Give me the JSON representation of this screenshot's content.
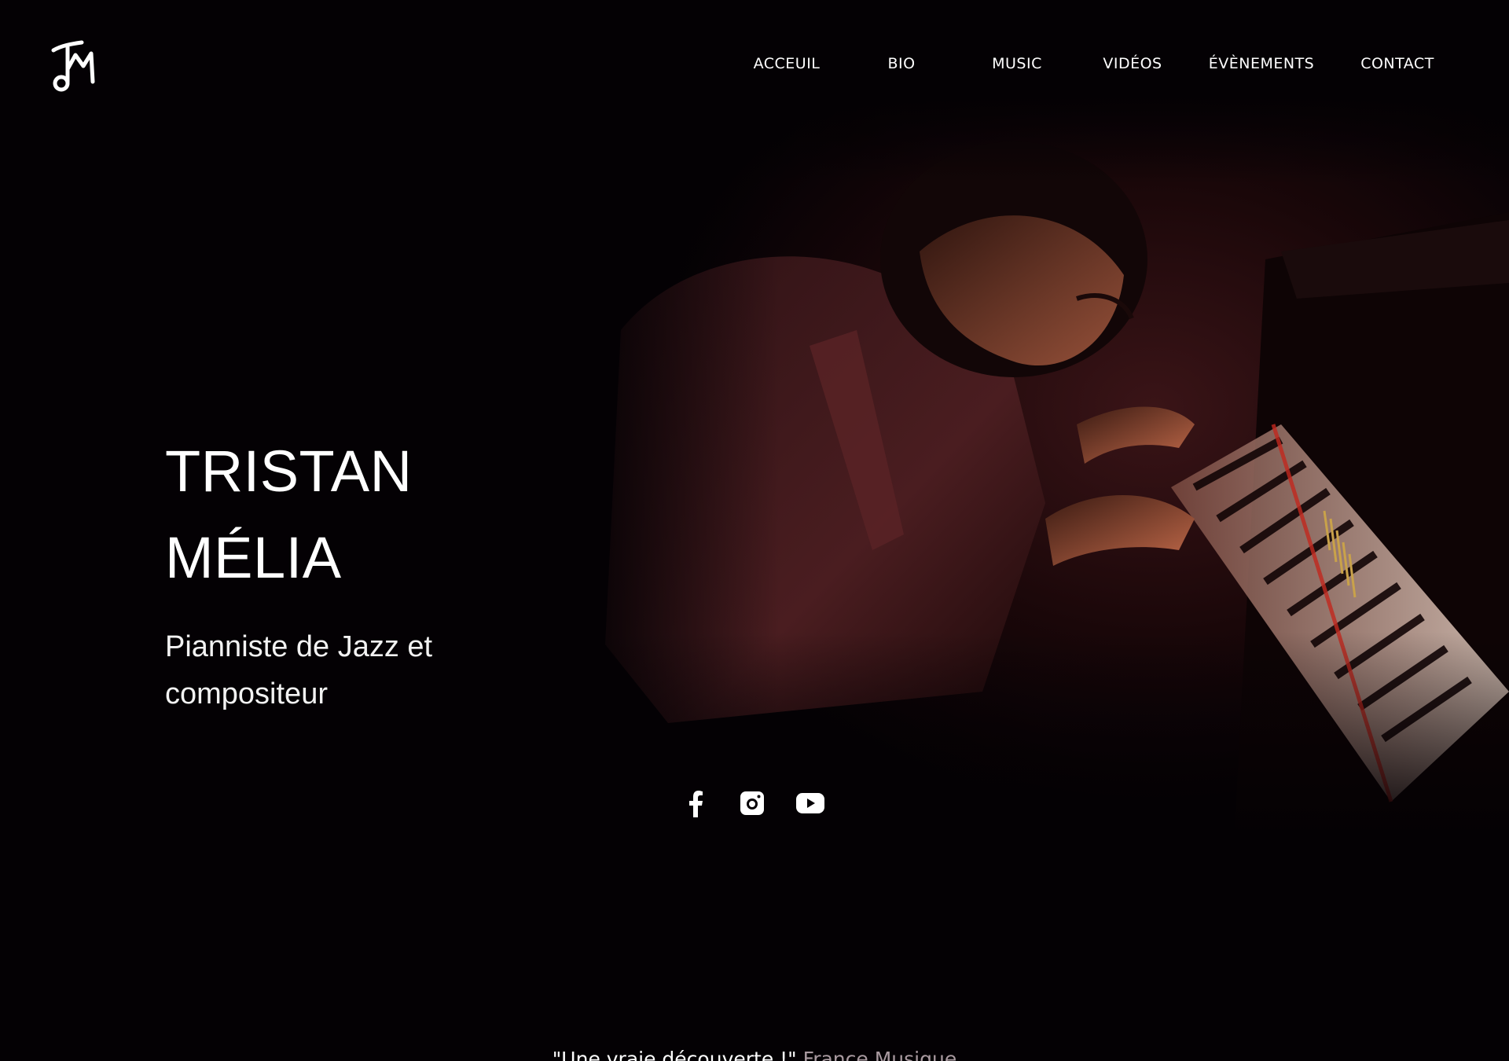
{
  "header": {
    "logo_text": "TM",
    "nav": [
      {
        "label": "ACCEUIL",
        "name": "nav-item-accueil"
      },
      {
        "label": "BIO",
        "name": "nav-item-bio"
      },
      {
        "label": "MUSIC",
        "name": "nav-item-music"
      },
      {
        "label": "VIDÉOS",
        "name": "nav-item-videos"
      },
      {
        "label": "ÉVÈNEMENTS",
        "name": "nav-item-evenements"
      },
      {
        "label": "CONTACT",
        "name": "nav-item-contact"
      }
    ]
  },
  "hero": {
    "name_line1": "TRISTAN",
    "name_line2": "MÉLIA",
    "tagline_line1": "Pianniste de Jazz et",
    "tagline_line2": "compositeur"
  },
  "social": [
    {
      "icon": "facebook-icon"
    },
    {
      "icon": "instagram-icon"
    },
    {
      "icon": "youtube-icon"
    }
  ],
  "quote": {
    "text": "\"Une vraie découverte !\"",
    "source": "France Musique"
  },
  "colors": {
    "background": "#040104",
    "text": "#ffffff",
    "quote_source": "#a99aa0",
    "accent_red": "#c2281e"
  }
}
